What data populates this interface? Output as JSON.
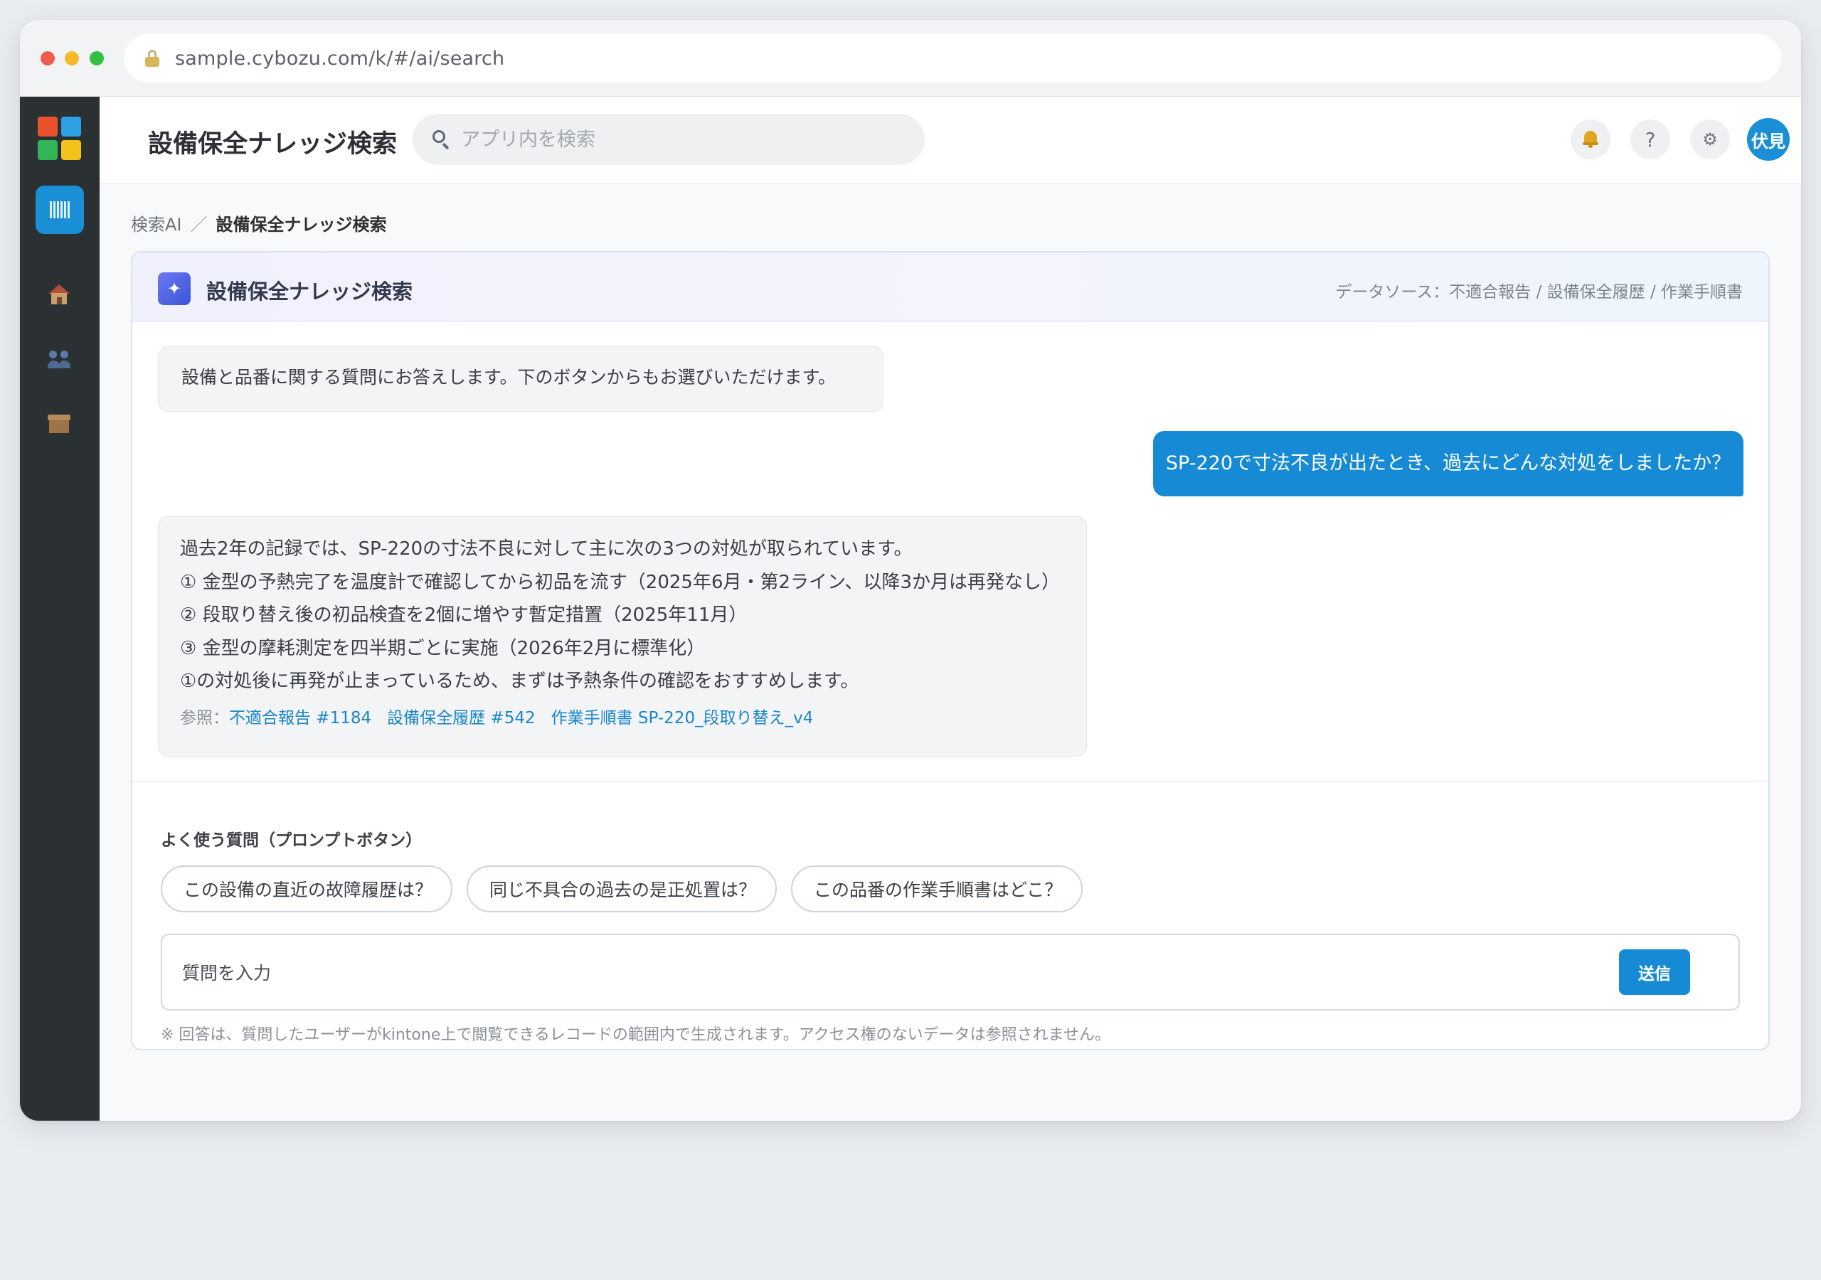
{
  "browser": {
    "url": "sample.cybozu.com/k/#/ai/search"
  },
  "sidebar": {
    "icons": [
      "kintone-logo",
      "app-icon",
      "home-icon",
      "users-icon",
      "box-icon"
    ]
  },
  "header": {
    "app_title": "設備保全ナレッジ検索",
    "search_placeholder": "アプリ内を検索",
    "help_label": "?",
    "gear_label": "⚙",
    "avatar_label": "伏見"
  },
  "breadcrumb": {
    "parent": "検索AI",
    "separator": "／",
    "current": "設備保全ナレッジ検索"
  },
  "panel": {
    "title": "設備保全ナレッジ検索",
    "spark_glyph": "✦",
    "datasource": "データソース：不適合報告 / 設備保全履歴 / 作業手順書"
  },
  "chat": {
    "system_message": "設備と品番に関する質問にお答えします。下のボタンからもお選びいただけます。",
    "user_message": "SP-220で寸法不良が出たとき、過去にどんな対処をしましたか？",
    "answer_lines": [
      "過去2年の記録では、SP-220の寸法不良に対して主に次の3つの対処が取られています。",
      "① 金型の予熱完了を温度計で確認してから初品を流す（2025年6月・第2ライン、以降3か月は再発なし）",
      "② 段取り替え後の初品検査を2個に増やす暫定措置（2025年11月）",
      "③ 金型の摩耗測定を四半期ごとに実施（2026年2月に標準化）",
      "①の対処後に再発が止まっているため、まずは予熱条件の確認をおすすめします。"
    ],
    "refs_label": "参照：",
    "refs": [
      "不適合報告 #1184",
      "設備保全履歴 #542",
      "作業手順書 SP-220_段取り替え_v4"
    ]
  },
  "prompts": {
    "heading": "よく使う質問（プロンプトボタン）",
    "chips": [
      "この設備の直近の故障履歴は？",
      "同じ不具合の過去の是正処置は？",
      "この品番の作業手順書はどこ？"
    ]
  },
  "input": {
    "placeholder": "質問を入力",
    "send_label": "送信"
  },
  "notice": "※ 回答は、質問したユーザーがkintone上で閲覧できるレコードの範囲内で生成されます。アクセス権のないデータは参照されません。",
  "colors": {
    "accent": "#168ad4",
    "sidebar": "#2b3133",
    "link": "#1a86c8"
  }
}
